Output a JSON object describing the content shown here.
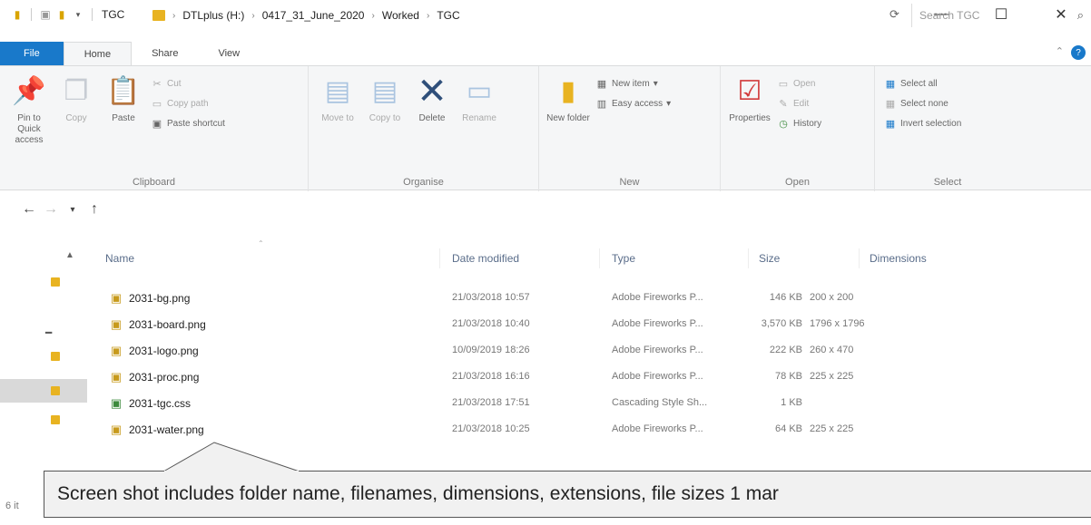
{
  "window": {
    "title": "TGC",
    "min_glyph": "—",
    "max_glyph": "☐",
    "close_glyph": "✕"
  },
  "ribbon_tabs": [
    {
      "label": "File"
    },
    {
      "label": "Home"
    },
    {
      "label": "Share"
    },
    {
      "label": "View"
    }
  ],
  "ribbon": {
    "pin_label": "Pin to Quick access",
    "copy_label": "Copy",
    "paste_label": "Paste",
    "cut_label": "Cut",
    "copy_path_label": "Copy path",
    "paste_shortcut_label": "Paste shortcut",
    "clipboard_group": "Clipboard",
    "move_to_label": "Move to",
    "copy_to_label": "Copy to",
    "delete_label": "Delete",
    "rename_label": "Rename",
    "organise_group": "Organise",
    "new_folder_label": "New folder",
    "new_item_label": "New item",
    "easy_access_label": "Easy access",
    "new_group": "New",
    "properties_label": "Properties",
    "open_label": "Open",
    "edit_label": "Edit",
    "history_label": "History",
    "open_group": "Open",
    "select_all_label": "Select all",
    "select_none_label": "Select none",
    "invert_selection_label": "Invert selection",
    "select_group": "Select"
  },
  "breadcrumb": [
    "DTLplus (H:)",
    "0417_31_June_2020",
    "Worked",
    "TGC"
  ],
  "search": {
    "placeholder": "Search TGC"
  },
  "columns": {
    "name": "Name",
    "date": "Date modified",
    "type": "Type",
    "size": "Size",
    "dimensions": "Dimensions"
  },
  "files": [
    {
      "name": "2031-bg.png",
      "date": "21/03/2018 10:57",
      "type": "Adobe Fireworks P...",
      "size": "146 KB",
      "dimensions": "200 x 200",
      "kind": "png"
    },
    {
      "name": "2031-board.png",
      "date": "21/03/2018 10:40",
      "type": "Adobe Fireworks P...",
      "size": "3,570 KB",
      "dimensions": "1796 x 1796",
      "kind": "png"
    },
    {
      "name": "2031-logo.png",
      "date": "10/09/2019 18:26",
      "type": "Adobe Fireworks P...",
      "size": "222 KB",
      "dimensions": "260 x 470",
      "kind": "png"
    },
    {
      "name": "2031-proc.png",
      "date": "21/03/2018 16:16",
      "type": "Adobe Fireworks P...",
      "size": "78 KB",
      "dimensions": "225 x 225",
      "kind": "png"
    },
    {
      "name": "2031-tgc.css",
      "date": "21/03/2018 17:51",
      "type": "Cascading Style Sh...",
      "size": "1 KB",
      "dimensions": "",
      "kind": "css"
    },
    {
      "name": "2031-water.png",
      "date": "21/03/2018 10:25",
      "type": "Adobe Fireworks P...",
      "size": "64 KB",
      "dimensions": "225 x 225",
      "kind": "png"
    }
  ],
  "status": {
    "item_count": "6 it"
  },
  "callout": {
    "text": "Screen shot includes folder name, filenames, dimensions, extensions, file sizes    1 mar"
  }
}
